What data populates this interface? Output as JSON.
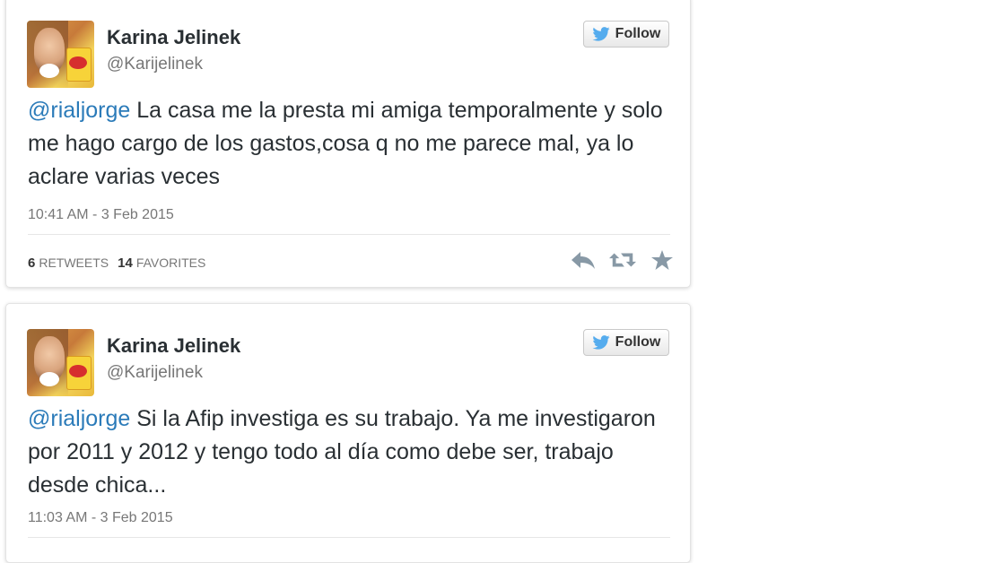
{
  "tweets": [
    {
      "name": "Karina Jelinek",
      "handle": "@Karijelinek",
      "follow_label": "Follow",
      "mention": "@rialjorge",
      "text": " La casa me la presta mi amiga temporalmente y solo me hago cargo de los gastos,cosa q no me parece mal, ya lo aclare varias veces",
      "timestamp": "10:41 AM - 3 Feb 2015",
      "retweets_count": "6",
      "retweets_label": "RETWEETS",
      "favorites_count": "14",
      "favorites_label": "FAVORITES"
    },
    {
      "name": "Karina Jelinek",
      "handle": "@Karijelinek",
      "follow_label": "Follow",
      "mention": "@rialjorge",
      "text": " Si la Afip investiga es su trabajo. Ya me investigaron por 2011 y 2012 y tengo todo al día como debe ser, trabajo desde chica...",
      "timestamp": "11:03 AM - 3 Feb 2015"
    }
  ],
  "icons": {
    "follow": "twitter-bird-icon",
    "reply": "reply-icon",
    "retweet": "retweet-icon",
    "favorite": "star-icon"
  },
  "colors": {
    "mention": "#2b7bb9",
    "twitter_blue": "#55acee",
    "text": "#292f33",
    "muted": "#777777"
  }
}
